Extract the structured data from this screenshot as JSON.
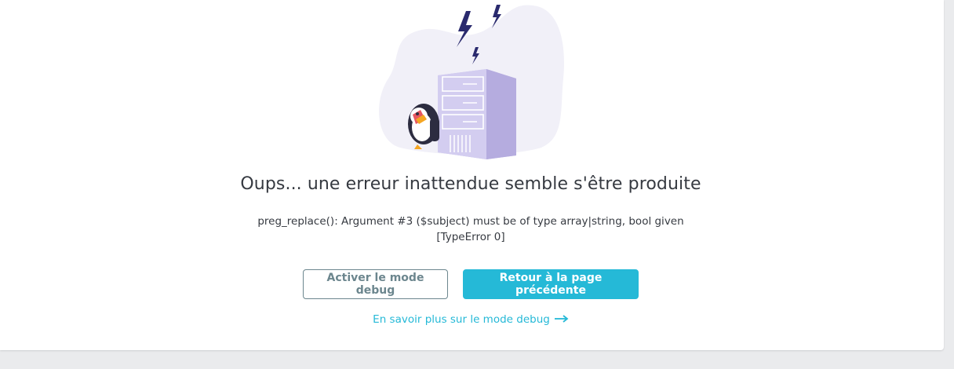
{
  "error": {
    "title": "Oups... une erreur inattendue semble s'être produite",
    "message_line1": "preg_replace(): Argument #3 ($subject) must be of type array|string, bool given",
    "message_line2": "[TypeError 0]"
  },
  "actions": {
    "debug_button": "Activer le mode debug",
    "back_button": "Retour à la page précédente",
    "learn_more_link": "En savoir plus sur le mode debug"
  },
  "colors": {
    "primary": "#25b9d7",
    "secondary": "#6c868e",
    "text": "#363a41",
    "illustration_blob": "#f1f0f8",
    "server": "#c7c0ea",
    "lightning": "#2a2a6e"
  },
  "icons": [
    "lightning-icon",
    "server-icon",
    "puffin-mascot",
    "arrow-right-icon"
  ]
}
